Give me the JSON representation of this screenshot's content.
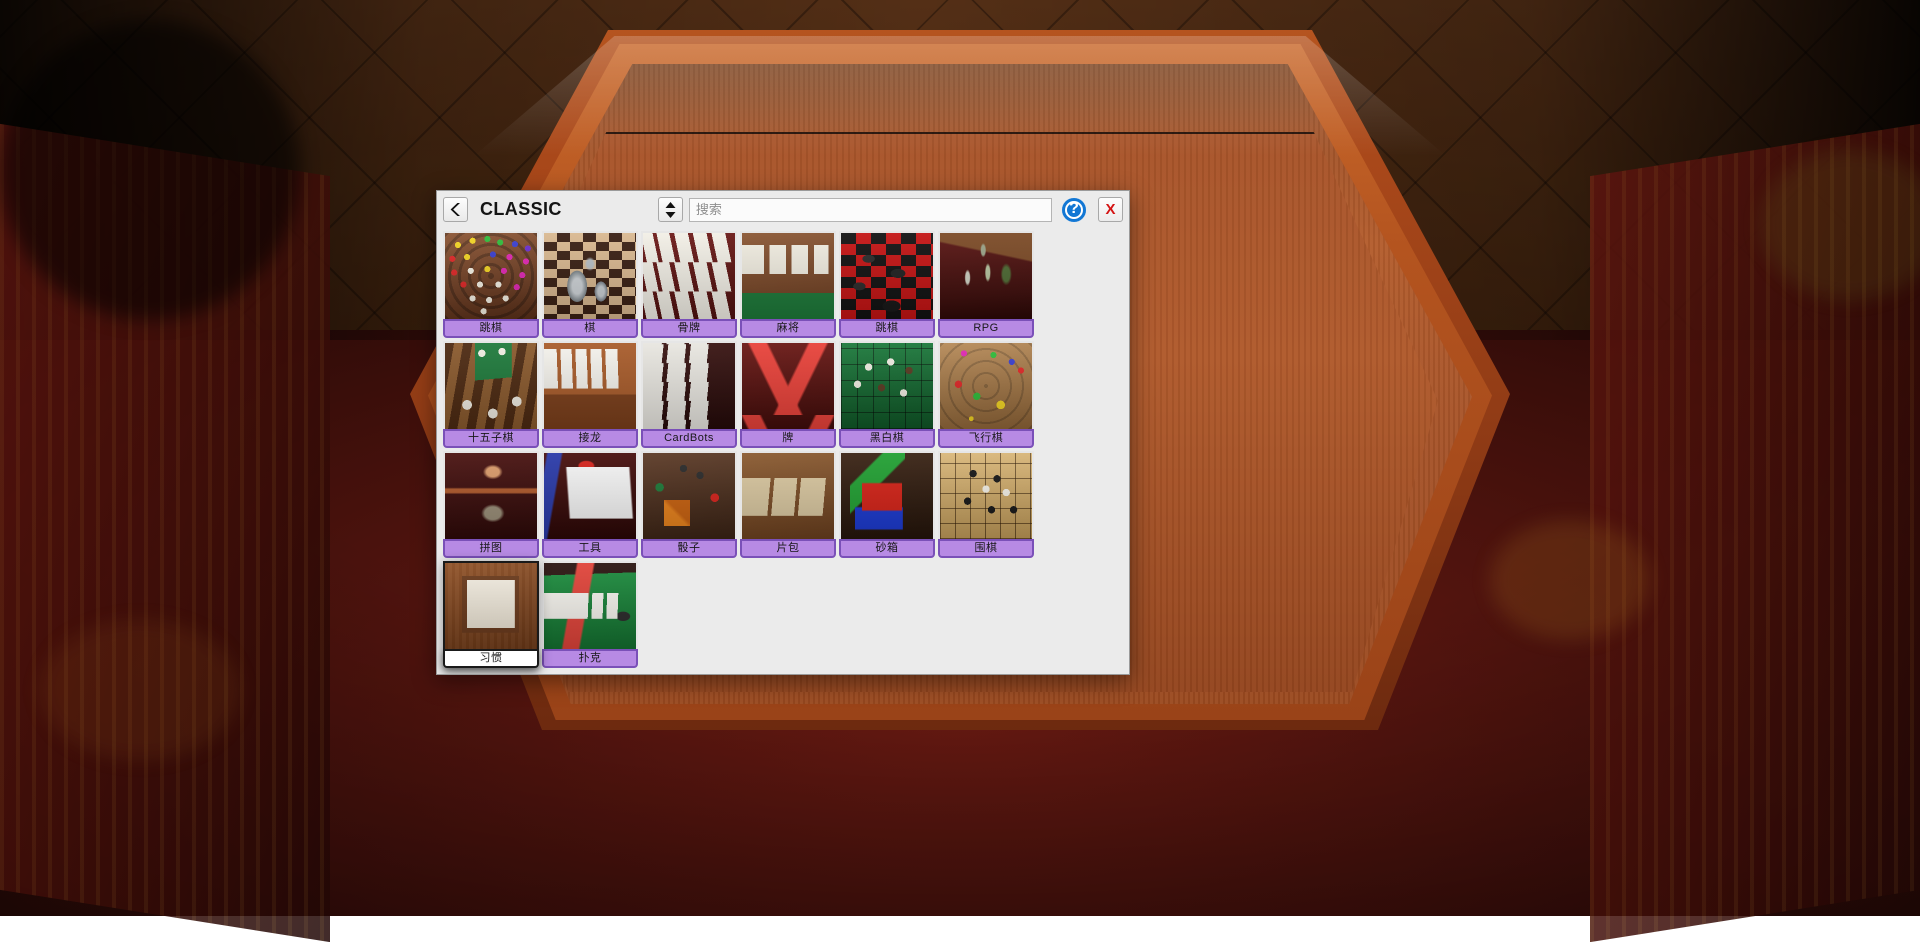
{
  "scene": {
    "description": "3D wooden hexagonal game table in a dim room with a red patterned rug",
    "table_wood_color": "#a6542a",
    "floor_color": "#43260f",
    "rug_color": "#4a120d"
  },
  "dialog": {
    "background_color": "#ebebeb",
    "accent_color": "#b78ae4",
    "accent_border_color": "#7a50b8",
    "header": {
      "back_button_icon": "chevron-left-icon",
      "category_title": "CLASSIC",
      "sort_button_icon": "sort-updown-icon",
      "search": {
        "value": "",
        "placeholder": "搜索"
      },
      "help_button_label": "?",
      "help_button_color": "#1277d4",
      "close_button_label": "X",
      "close_button_color": "#d41414"
    },
    "tiles": [
      {
        "label": "跳棋",
        "art": "art-chinesecheckers",
        "selected": false
      },
      {
        "label": "棋",
        "art": "art-chess",
        "selected": false
      },
      {
        "label": "骨牌",
        "art": "art-dominoes",
        "selected": false
      },
      {
        "label": "麻将",
        "art": "art-mahjong",
        "selected": false
      },
      {
        "label": "跳棋",
        "art": "art-checkers",
        "selected": false
      },
      {
        "label": "RPG",
        "art": "art-rpg",
        "selected": false
      },
      {
        "label": "十五子棋",
        "art": "art-backgammon",
        "selected": false
      },
      {
        "label": "接龙",
        "art": "art-solitaire",
        "selected": false
      },
      {
        "label": "CardBots",
        "art": "art-cardbots",
        "selected": false
      },
      {
        "label": "牌",
        "art": "art-cards",
        "selected": false
      },
      {
        "label": "黑白棋",
        "art": "art-reversi",
        "selected": false
      },
      {
        "label": "飞行棋",
        "art": "art-ludo",
        "selected": false
      },
      {
        "label": "拼图",
        "art": "art-puzzle",
        "selected": false
      },
      {
        "label": "工具",
        "art": "art-tools",
        "selected": false
      },
      {
        "label": "骰子",
        "art": "art-dice",
        "selected": false
      },
      {
        "label": "片包",
        "art": "art-tilepack",
        "selected": false
      },
      {
        "label": "砂箱",
        "art": "art-sandbox",
        "selected": false
      },
      {
        "label": "围棋",
        "art": "art-go",
        "selected": false
      },
      {
        "label": "习惯",
        "art": "art-custom",
        "selected": true
      },
      {
        "label": "扑克",
        "art": "art-poker",
        "selected": false
      }
    ]
  }
}
